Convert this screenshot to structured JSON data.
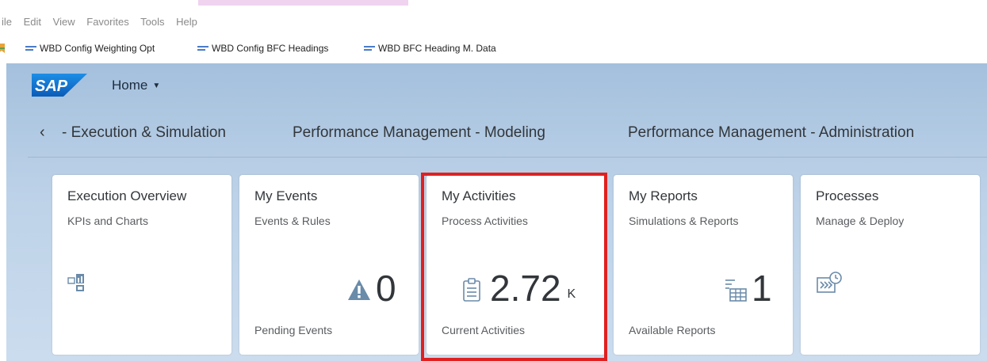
{
  "browser": {
    "menu": [
      "ile",
      "Edit",
      "View",
      "Favorites",
      "Tools",
      "Help"
    ],
    "favorites": [
      {
        "label": "WBD Config Weighting Opt"
      },
      {
        "label": "WBD Config BFC Headings"
      },
      {
        "label": "WBD BFC Heading M. Data"
      }
    ]
  },
  "header": {
    "logo_text": "SAP",
    "home_label": "Home"
  },
  "tabs": {
    "items": [
      {
        "label": "- Execution & Simulation"
      },
      {
        "label": "Performance Management - Modeling"
      },
      {
        "label": "Performance Management - Administration"
      }
    ]
  },
  "tiles": [
    {
      "title": "Execution Overview",
      "subtitle": "KPIs and Charts",
      "icon": "kpi-chart-icon",
      "value": "",
      "scale": "",
      "footer": ""
    },
    {
      "title": "My Events",
      "subtitle": "Events & Rules",
      "icon": "warning-icon",
      "value": "0",
      "scale": "",
      "footer": "Pending Events"
    },
    {
      "title": "My Activities",
      "subtitle": "Process Activities",
      "icon": "clipboard-icon",
      "value": "2.72",
      "scale": "K",
      "footer": "Current Activities"
    },
    {
      "title": "My Reports",
      "subtitle": "Simulations & Reports",
      "icon": "report-table-icon",
      "value": "1",
      "scale": "",
      "footer": "Available Reports"
    },
    {
      "title": "Processes",
      "subtitle": "Manage & Deploy",
      "icon": "process-deploy-icon",
      "value": "",
      "scale": "",
      "footer": ""
    }
  ],
  "colors": {
    "sap_blue": "#0a6ed1",
    "shell_background": "#bdd2e8",
    "highlight": "#e02020",
    "kpi_icon": "#6a8ba9"
  }
}
